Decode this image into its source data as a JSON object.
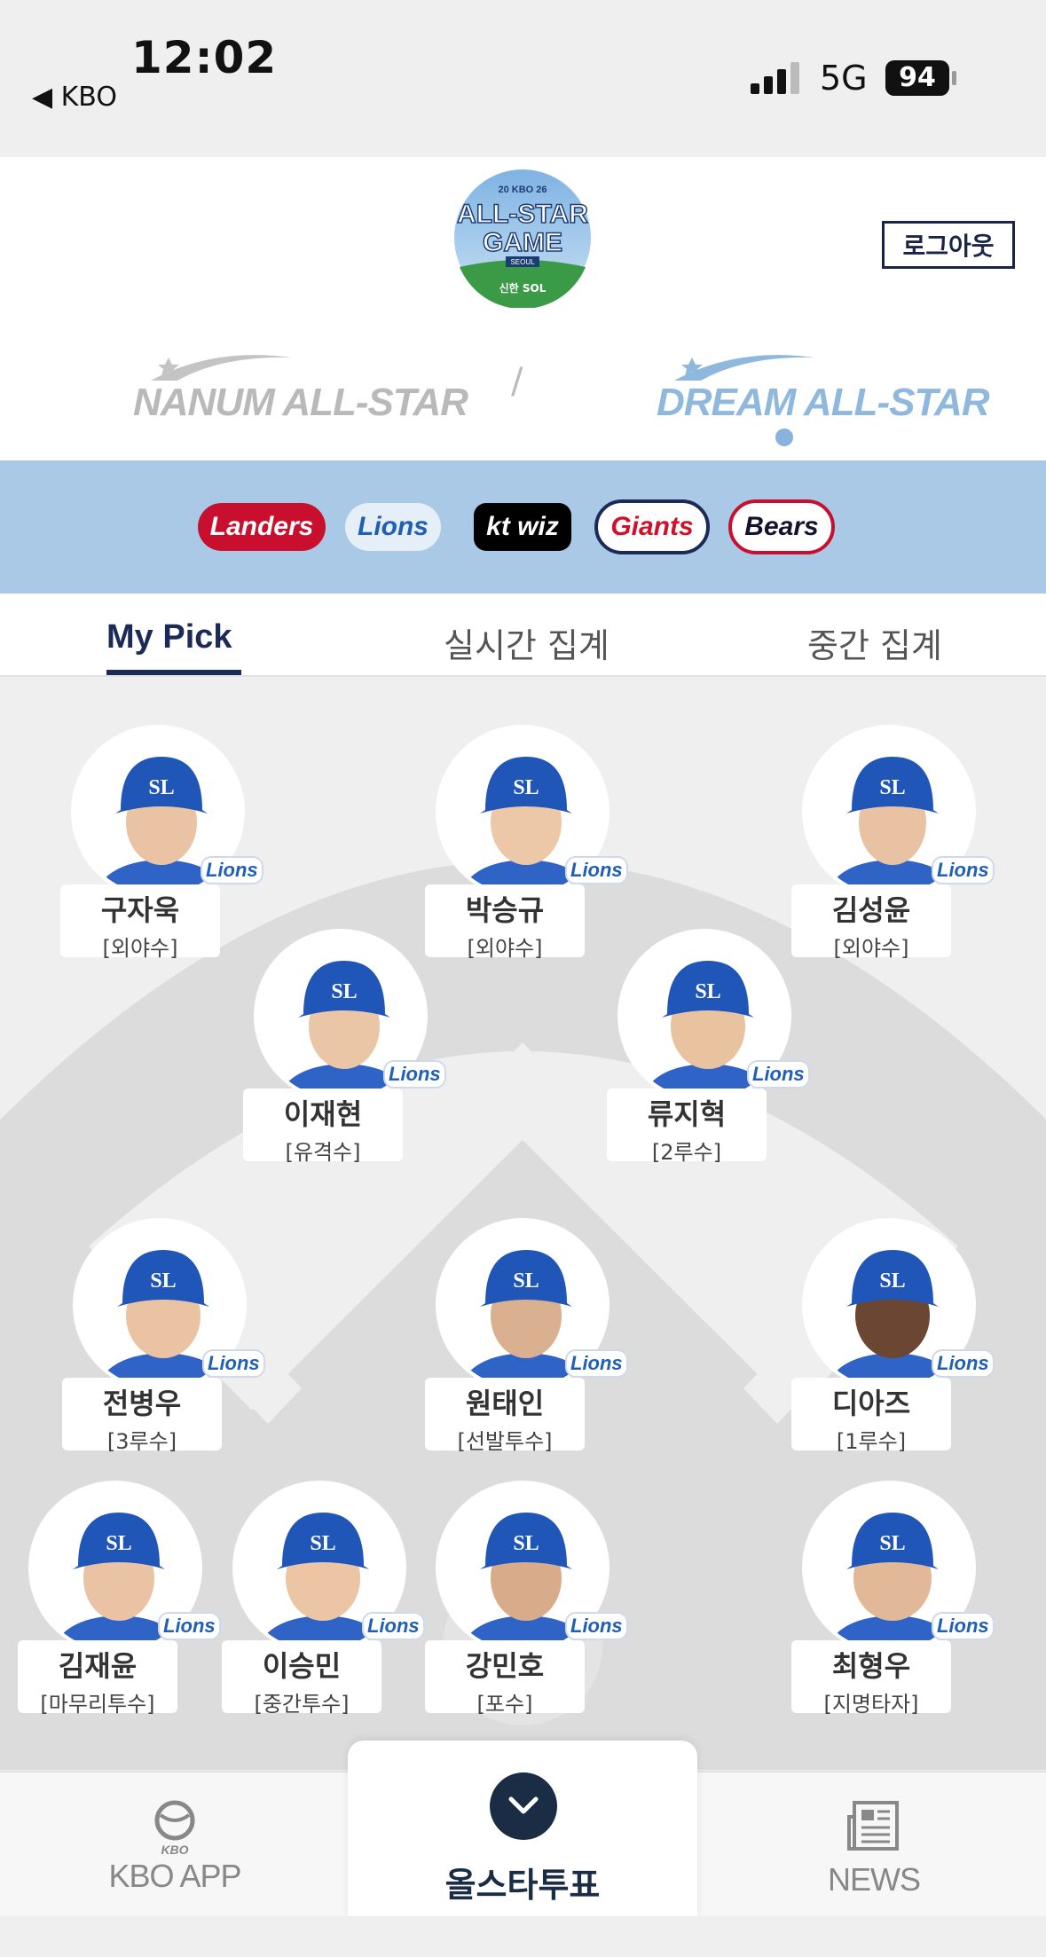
{
  "status_bar": {
    "time": "12:02",
    "back_app": "◀ KBO",
    "network": "5G",
    "battery": "94"
  },
  "header": {
    "logo_text_top": "20 KBO 26",
    "logo_text_main1": "ALL-STAR",
    "logo_text_main2": "GAME",
    "logo_text_sub": "SEOUL",
    "logo_sponsor": "신한 SOL",
    "logout_label": "로그아웃",
    "team_left": "NANUM ALL-STAR",
    "team_separator": "/",
    "team_right": "DREAM ALL-STAR",
    "selected_team": "DREAM ALL-STAR"
  },
  "clubs": [
    {
      "name": "Landers",
      "color": "#c8102e"
    },
    {
      "name": "Lions",
      "color": "#1f5fb5"
    },
    {
      "name": "kt wiz",
      "color": "#000000"
    },
    {
      "name": "Giants",
      "color": "#d0112b"
    },
    {
      "name": "Bears",
      "color": "#131230"
    }
  ],
  "tabs": [
    {
      "label": "My Pick",
      "active": true
    },
    {
      "label": "실시간 집계",
      "active": false
    },
    {
      "label": "중간 집계",
      "active": false
    }
  ],
  "players": [
    {
      "name": "구자욱",
      "position": "[외야수]"
    },
    {
      "name": "박승규",
      "position": "[외야수]"
    },
    {
      "name": "김성윤",
      "position": "[외야수]"
    },
    {
      "name": "이재현",
      "position": "[유격수]"
    },
    {
      "name": "류지혁",
      "position": "[2루수]"
    },
    {
      "name": "전병우",
      "position": "[3루수]"
    },
    {
      "name": "원태인",
      "position": "[선발투수]"
    },
    {
      "name": "디아즈",
      "position": "[1루수]"
    },
    {
      "name": "김재윤",
      "position": "[마무리투수]"
    },
    {
      "name": "이승민",
      "position": "[중간투수]"
    },
    {
      "name": "강민호",
      "position": "[포수]"
    },
    {
      "name": "최형우",
      "position": "[지명타자]"
    }
  ],
  "team_badge": "Lions",
  "cap_logo": "SL",
  "bottom_nav": {
    "left_label": "KBO APP",
    "left_logo_text": "KBO",
    "center_label": "올스타투표",
    "right_label": "NEWS"
  }
}
